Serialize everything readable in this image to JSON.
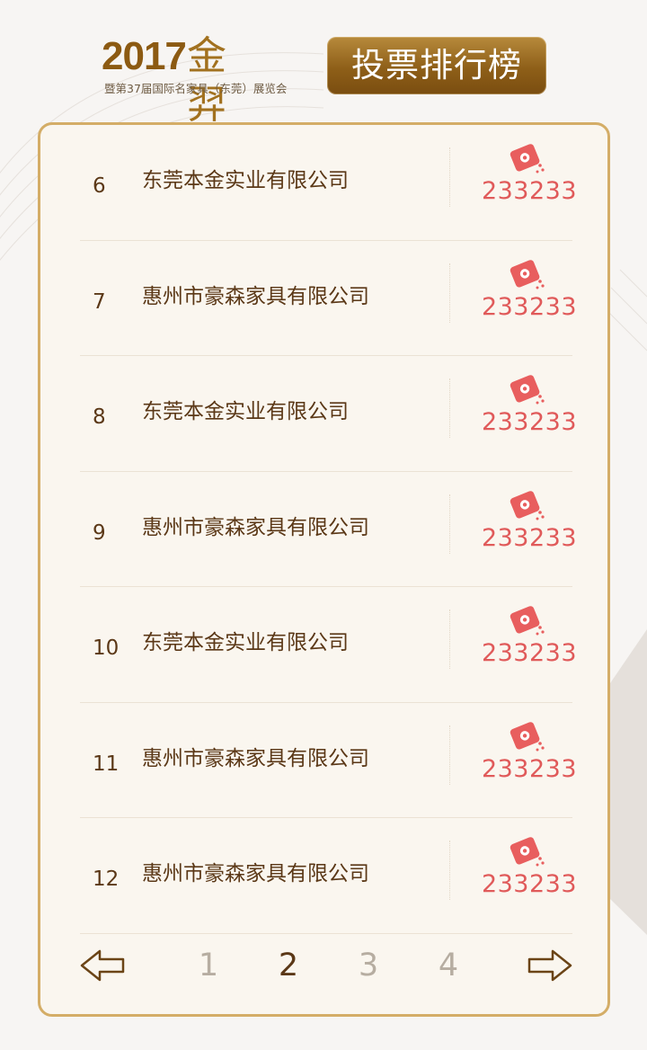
{
  "header": {
    "year": "2017",
    "award": "金羿奖",
    "subtitle": "暨第37届国际名家具（东莞）展览会",
    "badge": "投票排行榜"
  },
  "colors": {
    "brand_gold": "#a2711f",
    "text_brown": "#5b3817",
    "vote_red": "#e05a5a",
    "card_border": "#d4ad67"
  },
  "rows": [
    {
      "rank": "6",
      "company": "东莞本金实业有限公司",
      "votes": "233233",
      "icon": "vote-ticket-icon"
    },
    {
      "rank": "7",
      "company": "惠州市豪森家具有限公司",
      "votes": "233233",
      "icon": "vote-ticket-icon"
    },
    {
      "rank": "8",
      "company": "东莞本金实业有限公司",
      "votes": "233233",
      "icon": "vote-ticket-icon"
    },
    {
      "rank": "9",
      "company": "惠州市豪森家具有限公司",
      "votes": "233233",
      "icon": "vote-ticket-icon"
    },
    {
      "rank": "10",
      "company": "东莞本金实业有限公司",
      "votes": "233233",
      "icon": "vote-ticket-icon"
    },
    {
      "rank": "11",
      "company": "惠州市豪森家具有限公司",
      "votes": "233233",
      "icon": "vote-ticket-icon"
    },
    {
      "rank": "12",
      "company": "惠州市豪森家具有限公司",
      "votes": "233233",
      "icon": "vote-ticket-icon"
    }
  ],
  "pager": {
    "pages": [
      "1",
      "2",
      "3",
      "4"
    ],
    "current": "2",
    "prev_icon": "arrow-left-icon",
    "next_icon": "arrow-right-icon"
  }
}
